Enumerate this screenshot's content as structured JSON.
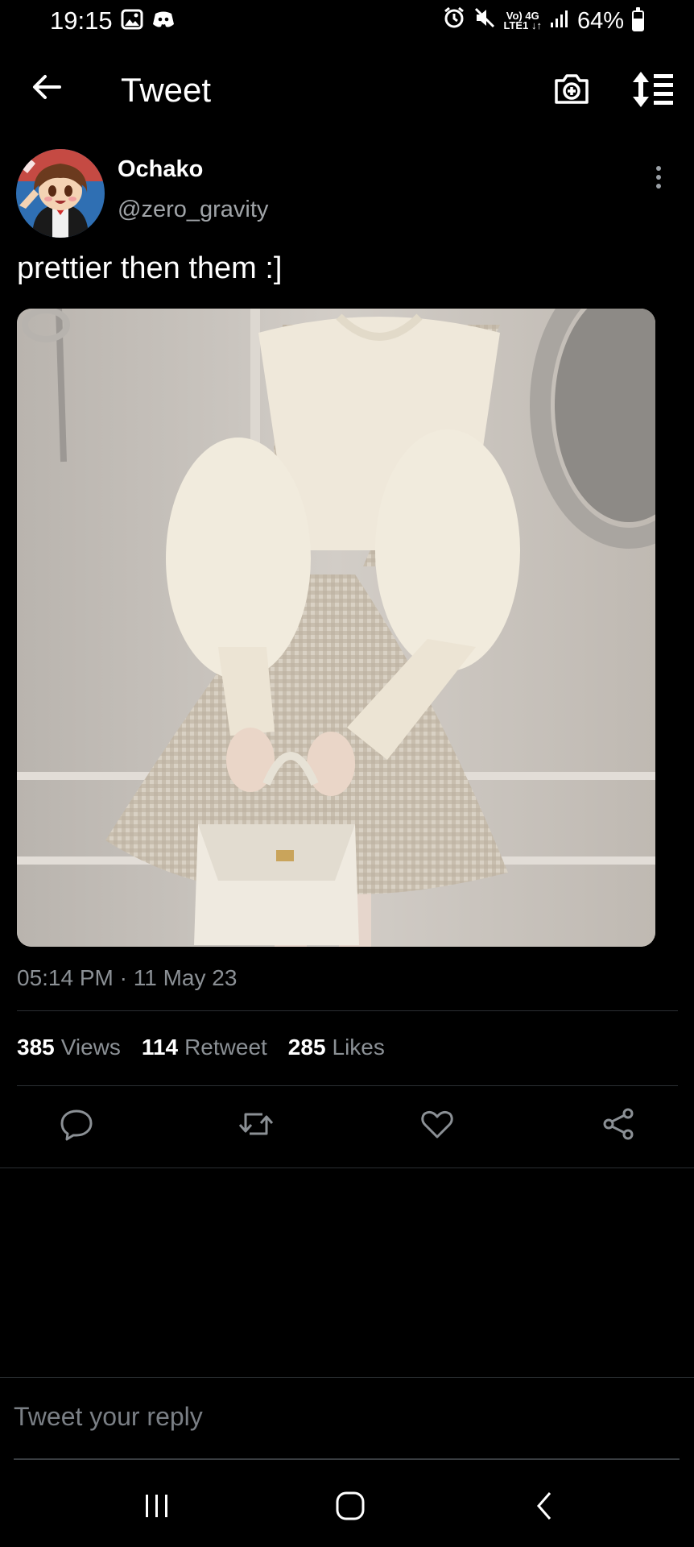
{
  "status_bar": {
    "time": "19:15",
    "network_top": "Vo) 4G",
    "network_bottom": "LTE1 ↓↑",
    "battery": "64%",
    "battery_level": 0.64,
    "icons": [
      "gallery-icon",
      "discord-icon",
      "alarm-icon",
      "mute-icon",
      "signal-icon",
      "battery-icon"
    ]
  },
  "header": {
    "title": "Tweet",
    "icons": [
      "back-arrow-icon",
      "camera-add-icon",
      "sort-list-icon"
    ]
  },
  "tweet": {
    "display_name": "Ochako",
    "handle": "@zero_gravity",
    "text": "prettier then them :]",
    "timestamp": "05:14 PM · 11 May 23",
    "stats": {
      "views": "385",
      "views_label": "Views",
      "retweets": "114",
      "retweets_label": "Retweet",
      "likes": "285",
      "likes_label": "Likes"
    },
    "actions": [
      "reply-icon",
      "retweet-icon",
      "like-icon",
      "share-icon"
    ]
  },
  "reply": {
    "placeholder": "Tweet your reply"
  },
  "navbar": [
    "recents-icon",
    "home-icon",
    "back-icon"
  ],
  "colors": {
    "background": "#000000",
    "muted_text": "#8b9095",
    "divider": "#2b2f33"
  }
}
